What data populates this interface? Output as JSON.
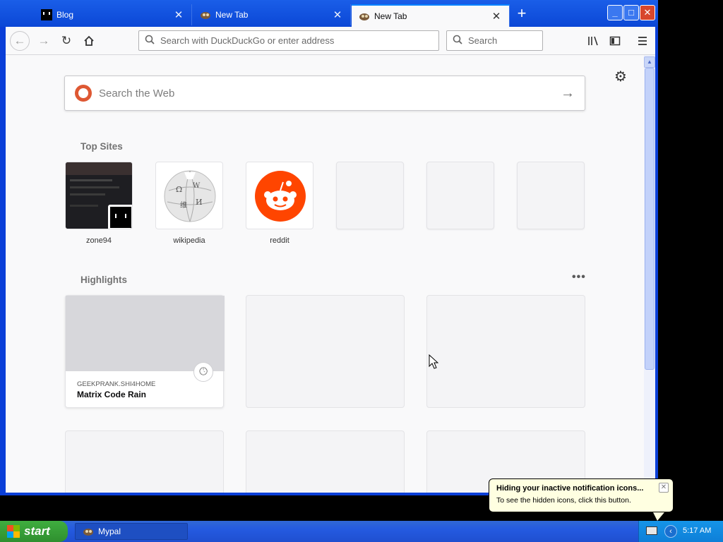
{
  "browser": {
    "tabs": [
      {
        "title": "Blog",
        "active": false,
        "favicon": "blog-favicon"
      },
      {
        "title": "New Tab",
        "active": false,
        "favicon": "mypal-favicon"
      },
      {
        "title": "New Tab",
        "active": true,
        "favicon": "mypal-favicon"
      }
    ],
    "new_tab_symbol": "+",
    "window_controls": {
      "minimize": "_",
      "maximize": "□",
      "close": "✕"
    },
    "urlbar": {
      "placeholder": "Search with DuckDuckGo or enter address"
    },
    "searchbar": {
      "placeholder": "Search"
    }
  },
  "newtab": {
    "websearch": {
      "placeholder": "Search the Web"
    },
    "top_sites_title": "Top Sites",
    "top_sites": [
      {
        "label": "zone94",
        "icon": "zone94-thumbnail"
      },
      {
        "label": "wikipedia",
        "icon": "wikipedia-globe-icon"
      },
      {
        "label": "reddit",
        "icon": "reddit-icon"
      },
      {
        "label": "",
        "icon": ""
      },
      {
        "label": "",
        "icon": ""
      },
      {
        "label": "",
        "icon": ""
      }
    ],
    "highlights_title": "Highlights",
    "highlights_more": "•••",
    "highlights": [
      {
        "host": "GEEKPRANK.SHI4HOME",
        "title": "Matrix Code Rain"
      }
    ]
  },
  "taskbar": {
    "start_label": "start",
    "task_label": "Mypal",
    "clock": "5:17 AM"
  },
  "balloon": {
    "title": "Hiding your inactive notification icons...",
    "text": "To see the hidden icons, click this button."
  },
  "colors": {
    "titlebar": "#0b47d6",
    "reddit": "#ff4500",
    "duckduckgo": "#de5833",
    "start": "#3fae3f"
  }
}
